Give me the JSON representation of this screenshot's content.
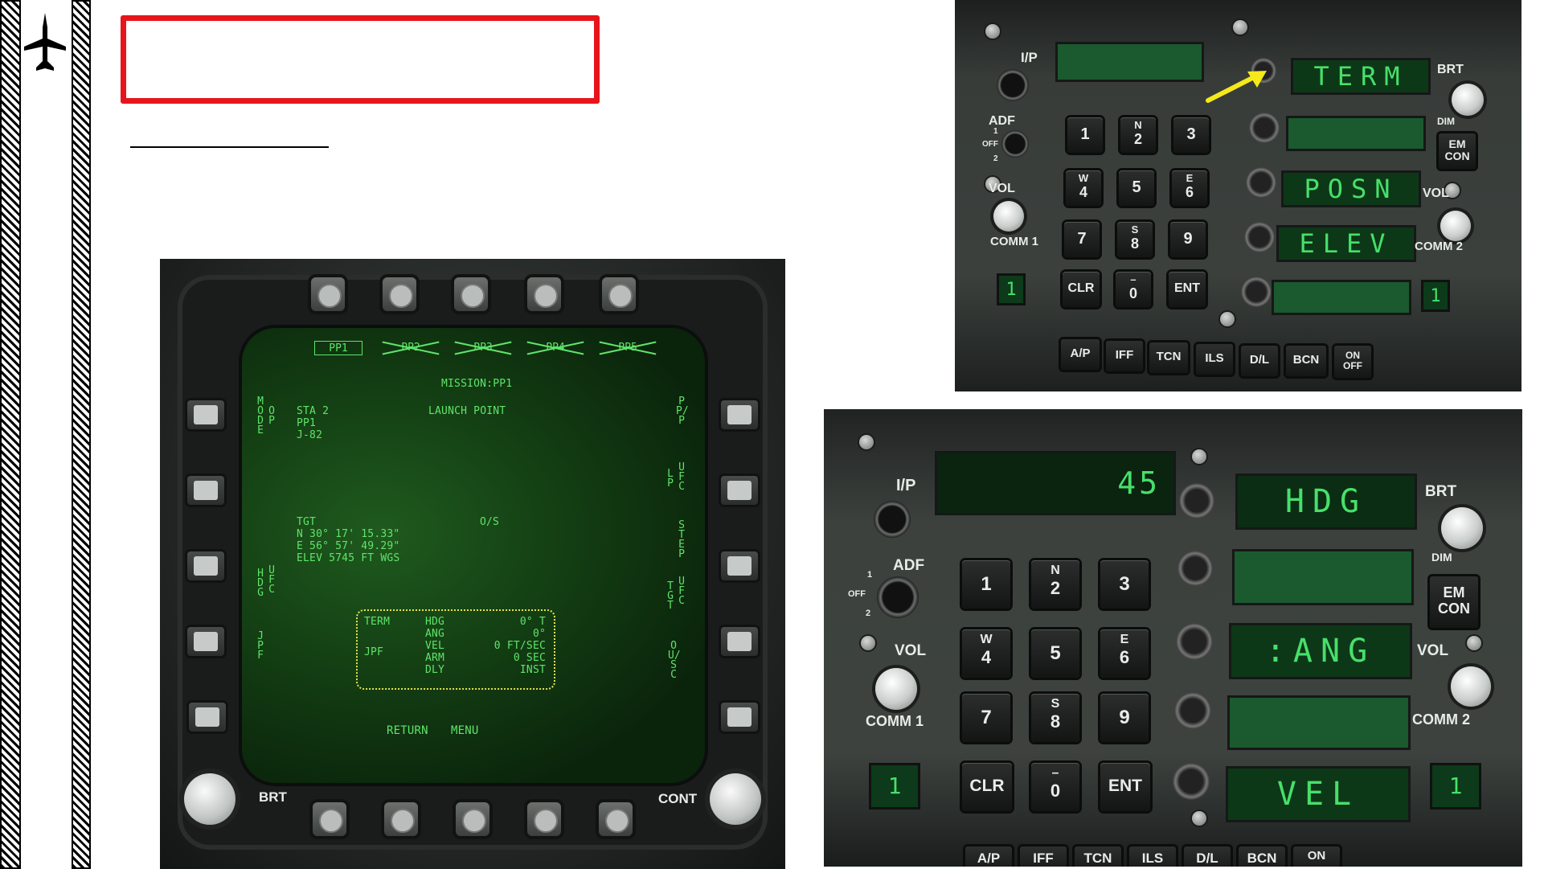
{
  "slide": {
    "title": "",
    "subtitle": ""
  },
  "ddi": {
    "pp_tabs": [
      {
        "label": "PP1",
        "active": true
      },
      {
        "label": "PP2",
        "active": false
      },
      {
        "label": "PP3",
        "active": false
      },
      {
        "label": "PP4",
        "active": false
      },
      {
        "label": "PP5",
        "active": false
      }
    ],
    "mission_title": "MISSION:PP1",
    "mode_label": "MODE",
    "op_label": "OP",
    "sta_info": "STA 2\nPP1\nJ-82",
    "launch_point": "LAUNCH POINT",
    "right_labels": {
      "top": "PP/P",
      "lpufc": "UFC",
      "lp": "LP",
      "step": "STEP",
      "tgt": "TGT",
      "tgt_ufc": "UFC",
      "ousc": "OU/SC"
    },
    "tgt_block": "TGT\nN 30° 17' 15.33\"\nE 56° 57' 49.29\"\nELEV 5745 FT WGS",
    "os_label": "O/S",
    "hdg_label": "HDG",
    "ufc_label": "UFC",
    "jpf_label": "JPF",
    "jpf": {
      "term": "TERM",
      "jpf": "JPF",
      "params": "HDG\nANG\nVEL\nARM\nDLY",
      "values": "0° T\n0°\n0 FT/SEC\n0 SEC\nINST"
    },
    "return_label": "RETURN",
    "menu_label": "MENU",
    "brt_label": "BRT",
    "cont_label": "CONT"
  },
  "ufc_top": {
    "ip_label": "I/P",
    "adf_label": "ADF",
    "adf_pos": [
      "1",
      "OFF",
      "2"
    ],
    "vol_left": "VOL",
    "comm1": "COMM 1",
    "comm2": "COMM 2",
    "vol_right": "VOL",
    "brt": "BRT",
    "dim": "DIM",
    "em_con": "EM\nCON",
    "option_displays": [
      "TERM",
      "",
      "POSN",
      "ELEV",
      ""
    ],
    "comm1_channel": "1",
    "comm2_channel": "1",
    "scratchpad": "",
    "keys": [
      {
        "main": "1",
        "sub": ""
      },
      {
        "main": "2",
        "sub": "N"
      },
      {
        "main": "3",
        "sub": ""
      },
      {
        "main": "4",
        "sub": "W"
      },
      {
        "main": "5",
        "sub": ""
      },
      {
        "main": "6",
        "sub": "E"
      },
      {
        "main": "7",
        "sub": ""
      },
      {
        "main": "8",
        "sub": "S"
      },
      {
        "main": "9",
        "sub": ""
      },
      {
        "main": "CLR",
        "sub": ""
      },
      {
        "main": "0",
        "sub": "–"
      },
      {
        "main": "ENT",
        "sub": ""
      }
    ],
    "func_buttons": [
      "A/P",
      "IFF",
      "TCN",
      "ILS",
      "D/L",
      "BCN",
      "ON\nOFF"
    ],
    "arrow_color": "#f5e91a"
  },
  "ufc_bottom": {
    "ip_label": "I/P",
    "adf_label": "ADF",
    "adf_pos": [
      "1",
      "OFF",
      "2"
    ],
    "vol_left": "VOL",
    "comm1": "COMM 1",
    "comm2": "COMM 2",
    "vol_right": "VOL",
    "brt": "BRT",
    "dim": "DIM",
    "em_con": "EM\nCON",
    "scratchpad": "45",
    "option_displays": [
      "HDG",
      "",
      ":ANG",
      "",
      "VEL"
    ],
    "comm1_channel": "1",
    "comm2_channel": "1",
    "keys": [
      {
        "main": "1",
        "sub": ""
      },
      {
        "main": "2",
        "sub": "N"
      },
      {
        "main": "3",
        "sub": ""
      },
      {
        "main": "4",
        "sub": "W"
      },
      {
        "main": "5",
        "sub": ""
      },
      {
        "main": "6",
        "sub": "E"
      },
      {
        "main": "7",
        "sub": ""
      },
      {
        "main": "8",
        "sub": "S"
      },
      {
        "main": "9",
        "sub": ""
      },
      {
        "main": "CLR",
        "sub": ""
      },
      {
        "main": "0",
        "sub": "–"
      },
      {
        "main": "ENT",
        "sub": ""
      }
    ],
    "func_buttons": [
      "A/P",
      "IFF",
      "TCN",
      "ILS",
      "D/L",
      "BCN",
      "ON"
    ]
  },
  "colors": {
    "title_box_border": "#e8141c",
    "mfd_green": "#5fe46a",
    "ufc_green": "#47e06a",
    "jpf_box": "#e6e24a"
  }
}
